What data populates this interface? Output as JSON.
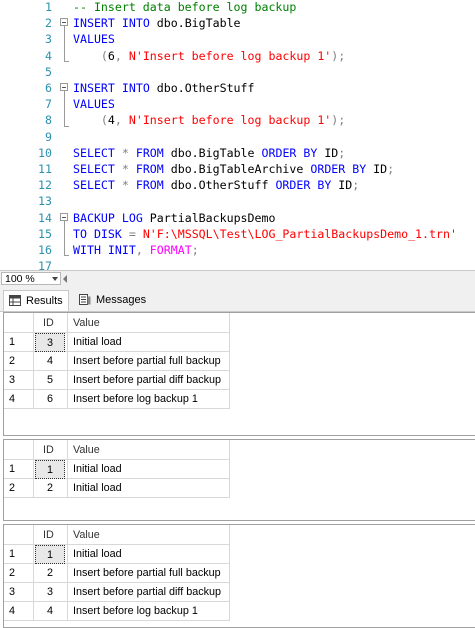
{
  "editor": {
    "lines": [
      {
        "n": "1",
        "tokens": [
          {
            "c": "c",
            "t": "-- Insert data before log backup"
          }
        ]
      },
      {
        "n": "2",
        "tokens": [
          {
            "c": "k",
            "t": "INSERT"
          },
          {
            "c": "t",
            "t": " "
          },
          {
            "c": "k",
            "t": "INTO"
          },
          {
            "c": "t",
            "t": " dbo.BigTable"
          }
        ]
      },
      {
        "n": "3",
        "tokens": [
          {
            "c": "k",
            "t": "VALUES"
          }
        ]
      },
      {
        "n": "4",
        "tokens": [
          {
            "c": "t",
            "t": "    "
          },
          {
            "c": "g",
            "t": "("
          },
          {
            "c": "t",
            "t": "6"
          },
          {
            "c": "g",
            "t": ","
          },
          {
            "c": "t",
            "t": " "
          },
          {
            "c": "s",
            "t": "N'Insert before log backup 1'"
          },
          {
            "c": "g",
            "t": ");"
          }
        ]
      },
      {
        "n": "5",
        "tokens": []
      },
      {
        "n": "6",
        "tokens": [
          {
            "c": "k",
            "t": "INSERT"
          },
          {
            "c": "t",
            "t": " "
          },
          {
            "c": "k",
            "t": "INTO"
          },
          {
            "c": "t",
            "t": " dbo.OtherStuff"
          }
        ]
      },
      {
        "n": "7",
        "tokens": [
          {
            "c": "k",
            "t": "VALUES"
          }
        ]
      },
      {
        "n": "8",
        "tokens": [
          {
            "c": "t",
            "t": "    "
          },
          {
            "c": "g",
            "t": "("
          },
          {
            "c": "t",
            "t": "4"
          },
          {
            "c": "g",
            "t": ","
          },
          {
            "c": "t",
            "t": " "
          },
          {
            "c": "s",
            "t": "N'Insert before log backup 1'"
          },
          {
            "c": "g",
            "t": ");"
          }
        ]
      },
      {
        "n": "9",
        "tokens": []
      },
      {
        "n": "10",
        "tokens": [
          {
            "c": "k",
            "t": "SELECT"
          },
          {
            "c": "t",
            "t": " "
          },
          {
            "c": "g",
            "t": "*"
          },
          {
            "c": "t",
            "t": " "
          },
          {
            "c": "k",
            "t": "FROM"
          },
          {
            "c": "t",
            "t": " dbo.BigTable "
          },
          {
            "c": "k",
            "t": "ORDER BY"
          },
          {
            "c": "t",
            "t": " ID"
          },
          {
            "c": "g",
            "t": ";"
          }
        ]
      },
      {
        "n": "11",
        "tokens": [
          {
            "c": "k",
            "t": "SELECT"
          },
          {
            "c": "t",
            "t": " "
          },
          {
            "c": "g",
            "t": "*"
          },
          {
            "c": "t",
            "t": " "
          },
          {
            "c": "k",
            "t": "FROM"
          },
          {
            "c": "t",
            "t": " dbo.BigTableArchive "
          },
          {
            "c": "k",
            "t": "ORDER BY"
          },
          {
            "c": "t",
            "t": " ID"
          },
          {
            "c": "g",
            "t": ";"
          }
        ]
      },
      {
        "n": "12",
        "tokens": [
          {
            "c": "k",
            "t": "SELECT"
          },
          {
            "c": "t",
            "t": " "
          },
          {
            "c": "g",
            "t": "*"
          },
          {
            "c": "t",
            "t": " "
          },
          {
            "c": "k",
            "t": "FROM"
          },
          {
            "c": "t",
            "t": " dbo.OtherStuff "
          },
          {
            "c": "k",
            "t": "ORDER BY"
          },
          {
            "c": "t",
            "t": " ID"
          },
          {
            "c": "g",
            "t": ";"
          }
        ]
      },
      {
        "n": "13",
        "tokens": []
      },
      {
        "n": "14",
        "tokens": [
          {
            "c": "k",
            "t": "BACKUP"
          },
          {
            "c": "t",
            "t": " "
          },
          {
            "c": "k",
            "t": "LOG"
          },
          {
            "c": "t",
            "t": " PartialBackupsDemo"
          }
        ]
      },
      {
        "n": "15",
        "tokens": [
          {
            "c": "k",
            "t": "TO"
          },
          {
            "c": "t",
            "t": " "
          },
          {
            "c": "k",
            "t": "DISK"
          },
          {
            "c": "t",
            "t": " "
          },
          {
            "c": "g",
            "t": "="
          },
          {
            "c": "t",
            "t": " "
          },
          {
            "c": "s",
            "t": "N'F:\\MSSQL\\Test\\LOG_PartialBackupsDemo_1.trn'"
          }
        ]
      },
      {
        "n": "16",
        "tokens": [
          {
            "c": "k",
            "t": "WITH"
          },
          {
            "c": "t",
            "t": " "
          },
          {
            "c": "k",
            "t": "INIT"
          },
          {
            "c": "g",
            "t": ","
          },
          {
            "c": "t",
            "t": " "
          },
          {
            "c": "m",
            "t": "FORMAT"
          },
          {
            "c": "g",
            "t": ";"
          }
        ]
      },
      {
        "n": "17",
        "tokens": []
      }
    ]
  },
  "statusbar": {
    "zoom": "100 %"
  },
  "tabs": {
    "results_label": "Results",
    "messages_label": "Messages"
  },
  "results": [
    {
      "columns": [
        "ID",
        "Value"
      ],
      "rows": [
        {
          "rn": "1",
          "id": "3",
          "value": "Initial load"
        },
        {
          "rn": "2",
          "id": "4",
          "value": "Insert before partial full backup"
        },
        {
          "rn": "3",
          "id": "5",
          "value": "Insert before partial diff backup"
        },
        {
          "rn": "4",
          "id": "6",
          "value": "Insert before log backup 1"
        }
      ]
    },
    {
      "columns": [
        "ID",
        "Value"
      ],
      "rows": [
        {
          "rn": "1",
          "id": "1",
          "value": "Initial load"
        },
        {
          "rn": "2",
          "id": "2",
          "value": "Initial load"
        }
      ]
    },
    {
      "columns": [
        "ID",
        "Value"
      ],
      "rows": [
        {
          "rn": "1",
          "id": "1",
          "value": "Initial load"
        },
        {
          "rn": "2",
          "id": "2",
          "value": "Insert before partial full backup"
        },
        {
          "rn": "3",
          "id": "3",
          "value": "Insert before partial diff backup"
        },
        {
          "rn": "4",
          "id": "4",
          "value": "Insert before log backup 1"
        }
      ]
    }
  ]
}
